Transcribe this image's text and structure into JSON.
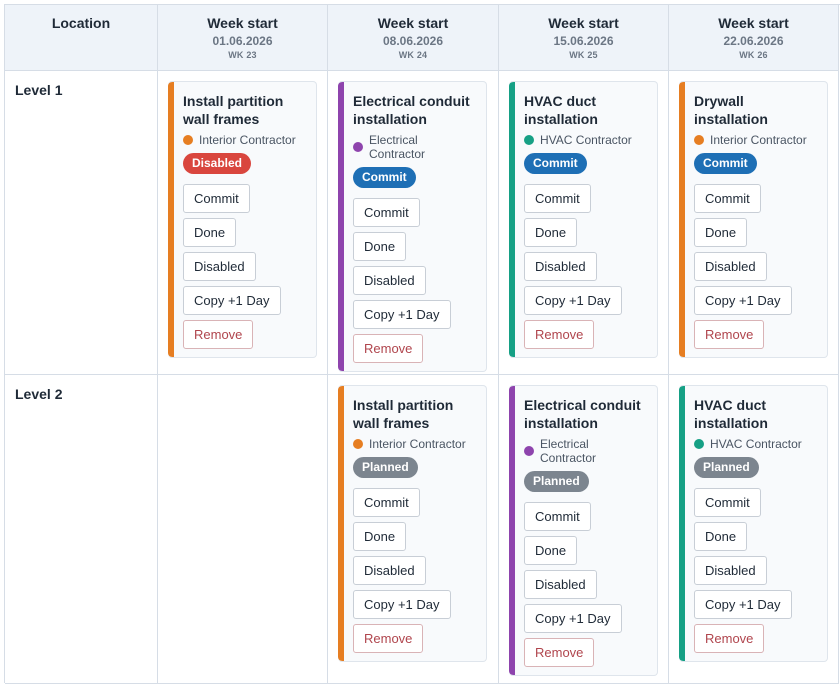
{
  "header": {
    "location_label": "Location",
    "weeks": [
      {
        "title": "Week start",
        "date": "01.06.2026",
        "wk": "WK 23"
      },
      {
        "title": "Week start",
        "date": "08.06.2026",
        "wk": "WK 24"
      },
      {
        "title": "Week start",
        "date": "15.06.2026",
        "wk": "WK 25"
      },
      {
        "title": "Week start",
        "date": "22.06.2026",
        "wk": "WK 26"
      }
    ]
  },
  "colors": {
    "interior": "#e67e22",
    "electrical": "#8e44ad",
    "hvac": "#16a085",
    "badge_disabled": "#d9463e",
    "badge_commit": "#1e6fb5",
    "badge_planned": "#7c858f"
  },
  "buttons": {
    "commit": "Commit",
    "done": "Done",
    "disabled": "Disabled",
    "copy": "Copy +1 Day",
    "remove": "Remove"
  },
  "rows": [
    {
      "label": "Level 1",
      "cards": [
        {
          "week": 0,
          "title": "Install partition wall frames",
          "contractor": "Interior Contractor",
          "color": "#e67e22",
          "badge": "Disabled",
          "badge_color": "#d9463e"
        },
        {
          "week": 1,
          "title": "Electrical conduit installation",
          "contractor": "Electrical Contractor",
          "color": "#8e44ad",
          "badge": "Commit",
          "badge_color": "#1e6fb5"
        },
        {
          "week": 2,
          "title": "HVAC duct installation",
          "contractor": "HVAC Contractor",
          "color": "#16a085",
          "badge": "Commit",
          "badge_color": "#1e6fb5"
        },
        {
          "week": 3,
          "title": "Drywall installation",
          "contractor": "Interior Contractor",
          "color": "#e67e22",
          "badge": "Commit",
          "badge_color": "#1e6fb5"
        }
      ]
    },
    {
      "label": "Level 2",
      "cards": [
        {
          "week": 1,
          "title": "Install partition wall frames",
          "contractor": "Interior Contractor",
          "color": "#e67e22",
          "badge": "Planned",
          "badge_color": "#7c858f"
        },
        {
          "week": 2,
          "title": "Electrical conduit installation",
          "contractor": "Electrical Contractor",
          "color": "#8e44ad",
          "badge": "Planned",
          "badge_color": "#7c858f"
        },
        {
          "week": 3,
          "title": "HVAC duct installation",
          "contractor": "HVAC Contractor",
          "color": "#16a085",
          "badge": "Planned",
          "badge_color": "#7c858f"
        }
      ]
    }
  ]
}
